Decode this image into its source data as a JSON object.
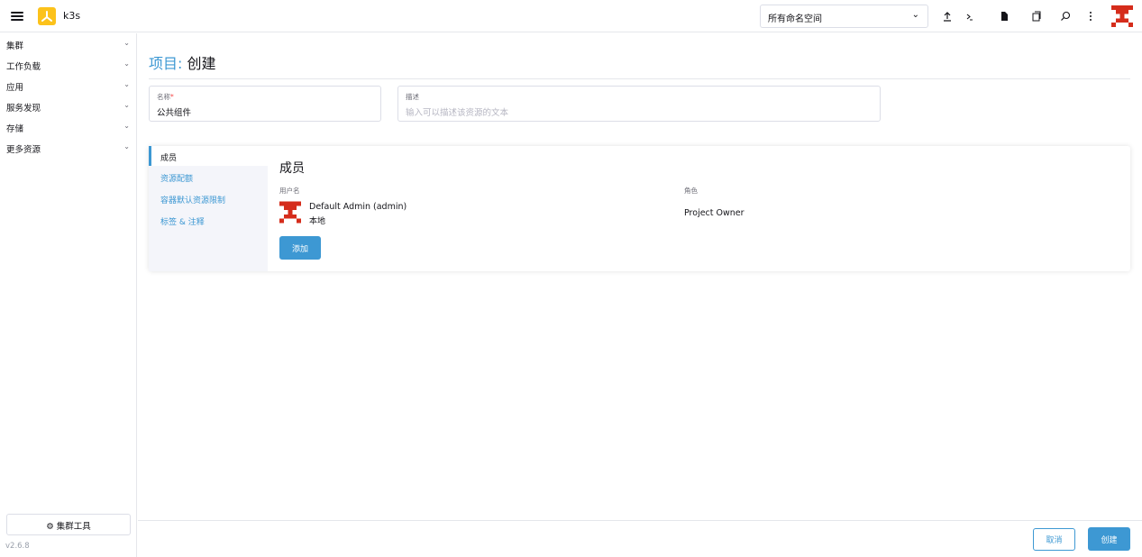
{
  "header": {
    "cluster_name": "k3s",
    "namespace_select": {
      "value": "所有命名空间"
    },
    "icons": [
      "upload-icon",
      "shell-icon",
      "file-icon",
      "copy-icon",
      "search-icon",
      "more-vertical-icon"
    ]
  },
  "sidebar": {
    "items": [
      {
        "label": "集群"
      },
      {
        "label": "工作负载"
      },
      {
        "label": "应用"
      },
      {
        "label": "服务发现"
      },
      {
        "label": "存储"
      },
      {
        "label": "更多资源"
      }
    ],
    "cluster_tools_label": "集群工具",
    "version": "v2.6.8"
  },
  "page": {
    "title_prefix": "项目:",
    "title_action": "创建"
  },
  "form": {
    "name": {
      "label": "名称",
      "required_mark": "*",
      "value": "公共组件"
    },
    "description": {
      "label": "描述",
      "placeholder": "输入可以描述该资源的文本"
    }
  },
  "tabs": [
    {
      "label": "成员",
      "active": true
    },
    {
      "label": "资源配额",
      "active": false
    },
    {
      "label": "容器默认资源限制",
      "active": false
    },
    {
      "label": "标签 & 注释",
      "active": false
    }
  ],
  "members_panel": {
    "title": "成员",
    "columns": {
      "username": "用户名",
      "role": "角色"
    },
    "members": [
      {
        "name": "Default Admin (admin)",
        "source": "本地",
        "role": "Project Owner"
      }
    ],
    "add_label": "添加"
  },
  "footer": {
    "cancel_label": "取消",
    "create_label": "创建"
  },
  "colors": {
    "accent": "#3d98d3",
    "logo": "#fcc21b",
    "avatar_red": "#d52c1b",
    "required": "#f64747"
  }
}
